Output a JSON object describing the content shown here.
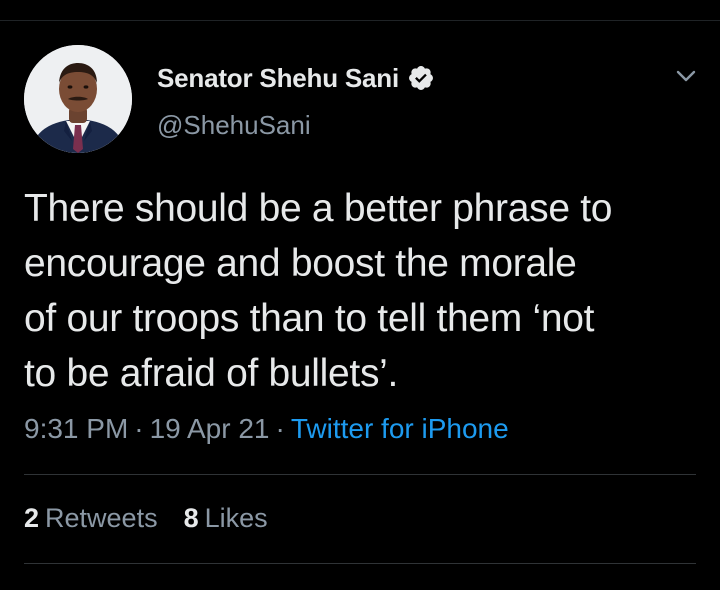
{
  "author": {
    "display_name": "Senator Shehu Sani",
    "handle": "@ShehuSani",
    "verified": true
  },
  "tweet": {
    "text": "There should be a better phrase to\nencourage and boost the morale\nof our troops than to tell them ‘not\nto be afraid of bullets’."
  },
  "meta": {
    "time": "9:31 PM",
    "separator": "·",
    "date": "19 Apr 21",
    "source": "Twitter for iPhone"
  },
  "stats": {
    "retweets_count": "2",
    "retweets_label": "Retweets",
    "likes_count": "8",
    "likes_label": "Likes"
  },
  "icons": {
    "verified": "verified-badge-icon",
    "menu": "chevron-down-icon"
  },
  "colors": {
    "background": "#000000",
    "text_primary": "#e7e9ea",
    "text_secondary": "#8b98a5",
    "link": "#1d9bf0",
    "divider": "#2f3336"
  }
}
